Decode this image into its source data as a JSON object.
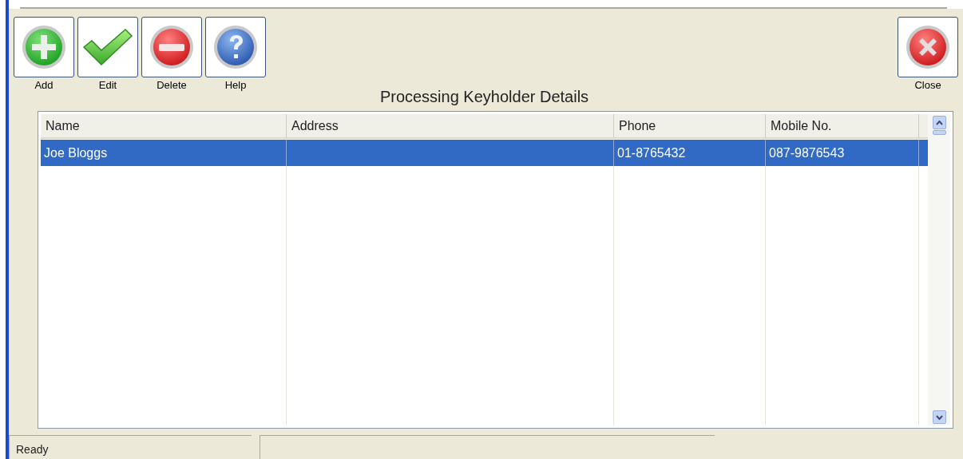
{
  "toolbar": [
    {
      "kind": "add",
      "label": "Add"
    },
    {
      "kind": "edit",
      "label": "Edit"
    },
    {
      "kind": "delete",
      "label": "Delete"
    },
    {
      "kind": "help",
      "label": "Help"
    }
  ],
  "close_button": {
    "kind": "close",
    "label": "Close"
  },
  "title": "Processing Keyholder Details",
  "table": {
    "columns": [
      "Name",
      "Address",
      "Phone",
      "Mobile No."
    ],
    "rows": [
      {
        "cells": [
          "Joe Bloggs",
          "",
          "01-8765432",
          "087-9876543"
        ],
        "selected": true
      }
    ]
  },
  "status_bar": [
    "Ready"
  ]
}
